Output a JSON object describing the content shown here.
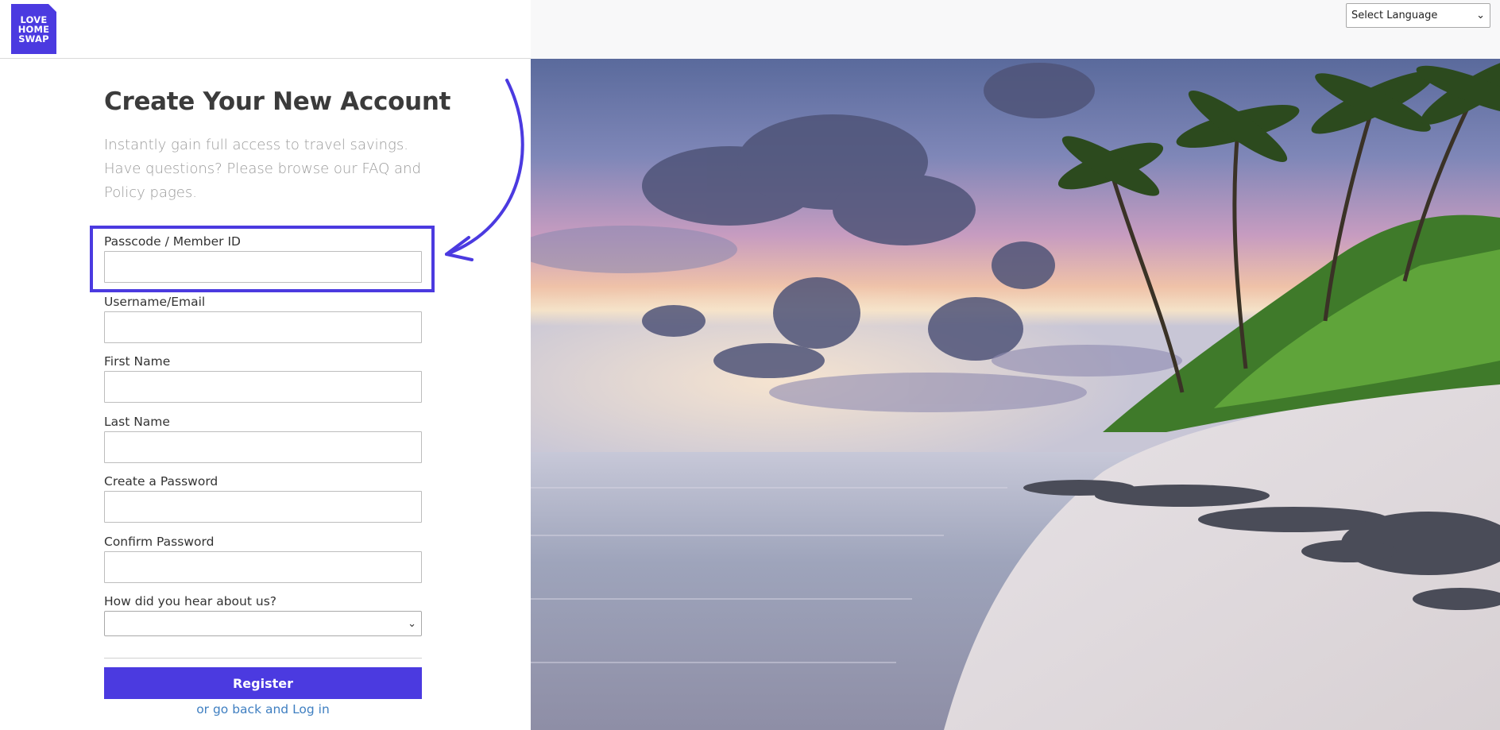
{
  "logo": {
    "lines": [
      "LOVE",
      "HOME",
      "SWAP"
    ]
  },
  "language": {
    "selected": "Select Language"
  },
  "page": {
    "title": "Create Your New Account",
    "subtitle": "Instantly gain full access to travel savings. Have questions? Please browse our FAQ and Policy pages."
  },
  "form": {
    "passcode_label": "Passcode / Member ID",
    "username_label": "Username/Email",
    "first_name_label": "First Name",
    "last_name_label": "Last Name",
    "password_label": "Create a Password",
    "confirm_password_label": "Confirm Password",
    "hear_about_label": "How did you hear about us?",
    "hear_about_value": "",
    "register_label": "Register",
    "login_link_text": "or go back and Log in"
  },
  "colors": {
    "brand": "#4b3ae0",
    "link": "#3f7fc1"
  }
}
